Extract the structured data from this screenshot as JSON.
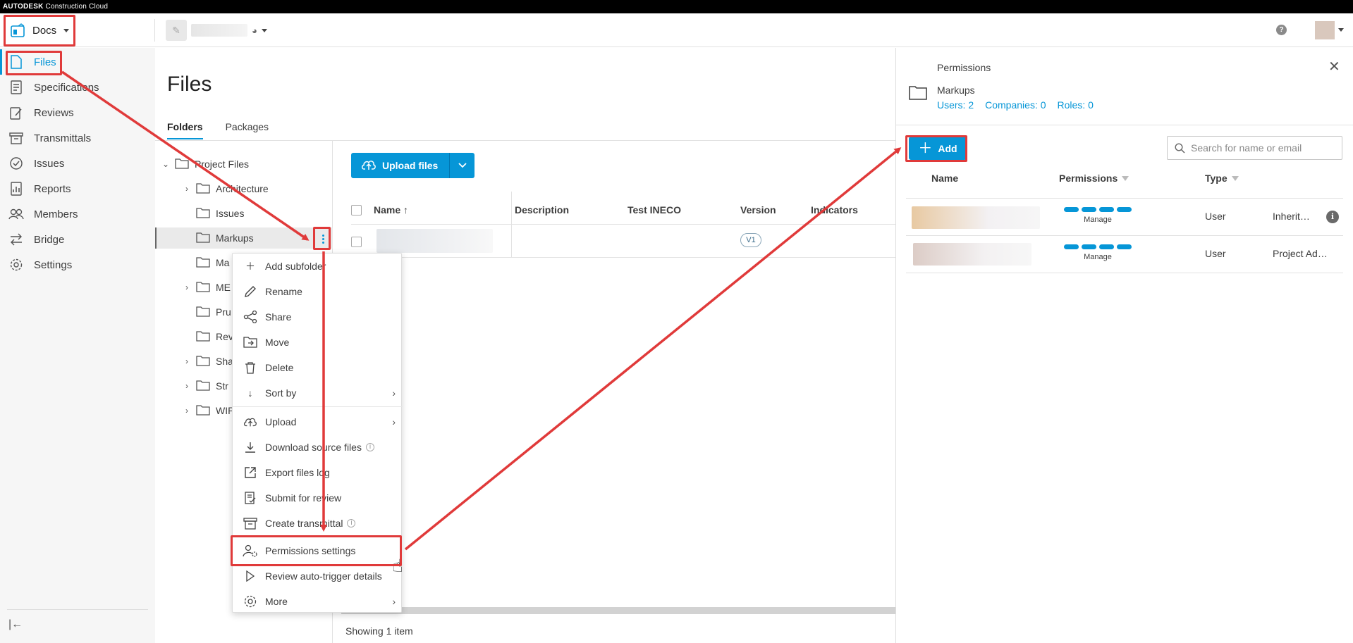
{
  "brand": {
    "name": "AUTODESK",
    "product": "Construction Cloud"
  },
  "header": {
    "module": "Docs",
    "help_icon": "question-icon",
    "help_glyph": "?"
  },
  "sidebar": {
    "items": [
      {
        "label": "Files",
        "icon": "file-icon",
        "active": true
      },
      {
        "label": "Specifications",
        "icon": "specifications-icon"
      },
      {
        "label": "Reviews",
        "icon": "reviews-icon"
      },
      {
        "label": "Transmittals",
        "icon": "transmittals-icon"
      },
      {
        "label": "Issues",
        "icon": "issues-icon"
      },
      {
        "label": "Reports",
        "icon": "reports-icon"
      },
      {
        "label": "Members",
        "icon": "members-icon"
      },
      {
        "label": "Bridge",
        "icon": "bridge-icon"
      },
      {
        "label": "Settings",
        "icon": "settings-icon"
      }
    ],
    "collapse_glyph": "|←"
  },
  "main": {
    "title": "Files",
    "tabs": [
      {
        "label": "Folders",
        "active": true
      },
      {
        "label": "Packages"
      }
    ],
    "tree": [
      {
        "label": "Project Files",
        "expanded": true
      },
      {
        "label": "Architecture",
        "has_children": true
      },
      {
        "label": "Issues"
      },
      {
        "label": "Markups",
        "selected": true
      },
      {
        "label": "Ma"
      },
      {
        "label": "ME",
        "has_children": true
      },
      {
        "label": "Pru"
      },
      {
        "label": "Rev"
      },
      {
        "label": "Sha",
        "has_children": true
      },
      {
        "label": "Str",
        "has_children": true
      },
      {
        "label": "WIP",
        "has_children": true
      }
    ],
    "upload_label": "Upload files",
    "columns": {
      "name": "Name",
      "description": "Description",
      "test": "Test INECO",
      "version": "Version",
      "indicators": "Indicators"
    },
    "row_version": "V1",
    "footer": "Showing 1 item"
  },
  "context_menu": {
    "items": [
      {
        "label": "Add subfolder",
        "icon": "plus-icon"
      },
      {
        "label": "Rename",
        "icon": "pencil-icon"
      },
      {
        "label": "Share",
        "icon": "share-icon"
      },
      {
        "label": "Move",
        "icon": "move-icon"
      },
      {
        "label": "Delete",
        "icon": "trash-icon"
      },
      {
        "label": "Sort by",
        "icon": "sort-arrow-icon",
        "submenu": true
      },
      {
        "label": "Upload",
        "icon": "cloud-upload-icon",
        "submenu": true
      },
      {
        "label": "Download source files",
        "icon": "download-icon",
        "info": true
      },
      {
        "label": "Export files log",
        "icon": "export-icon"
      },
      {
        "label": "Submit for review",
        "icon": "review-icon"
      },
      {
        "label": "Create transmittal",
        "icon": "transmittal-icon",
        "info": true
      },
      {
        "label": "Permissions settings",
        "icon": "user-gear-icon"
      },
      {
        "label": "Review auto-trigger details",
        "icon": "play-icon"
      },
      {
        "label": "More",
        "icon": "gear-icon",
        "submenu": true
      }
    ]
  },
  "permissions": {
    "title": "Permissions",
    "folder": "Markups",
    "users": "Users: 2",
    "companies": "Companies: 0",
    "roles": "Roles: 0",
    "add_label": "Add",
    "search_placeholder": "Search for name or email",
    "columns": {
      "name": "Name",
      "permissions": "Permissions",
      "type": "Type"
    },
    "rows": [
      {
        "level": "Manage",
        "type": "User",
        "extra": "Inherit…",
        "info": true,
        "swatch": "#e8c9a2"
      },
      {
        "level": "Manage",
        "type": "User",
        "extra": "Project Ad…",
        "info": false,
        "swatch": "#dcccc6"
      }
    ]
  },
  "colors": {
    "accent": "#0696d7",
    "annotation": "#e03a3a",
    "sidebar_bg": "#f6f6f6"
  }
}
